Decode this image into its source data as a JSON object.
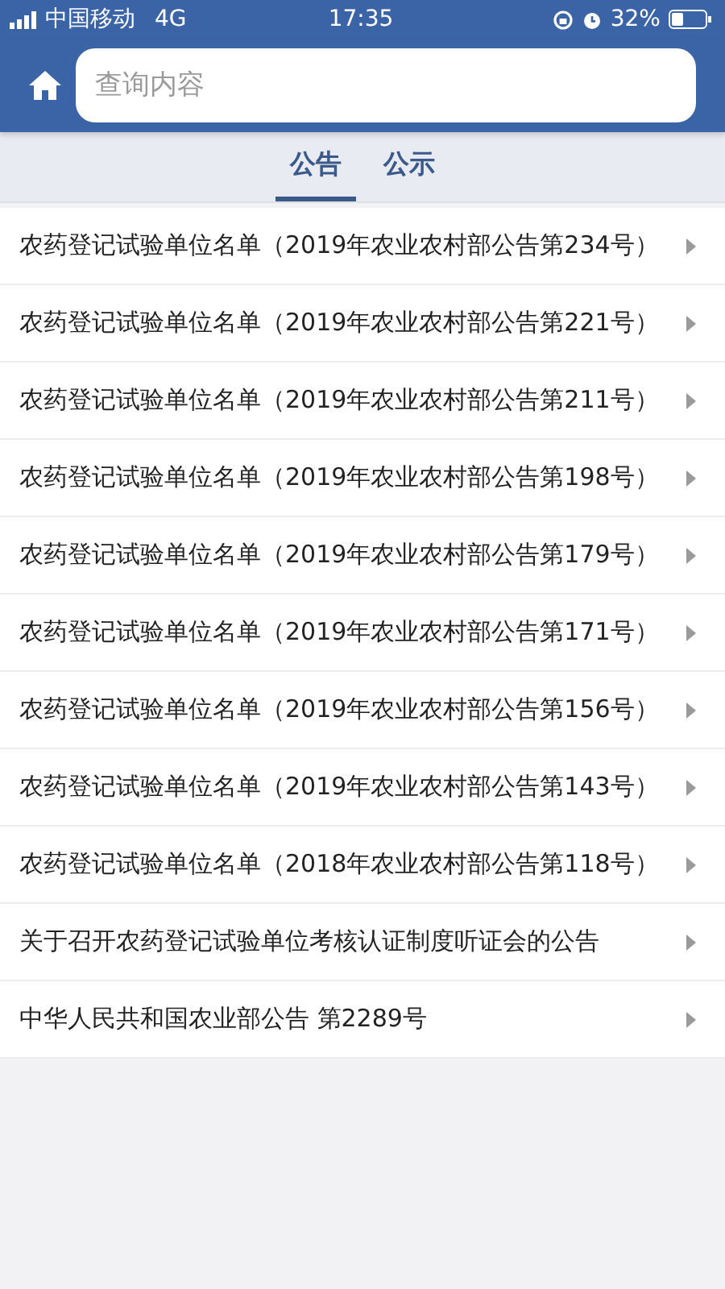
{
  "status_bar": {
    "carrier": "中国移动",
    "network": "4G",
    "time": "17:35",
    "battery": "32%"
  },
  "header": {
    "search": {
      "placeholder": "查询内容"
    }
  },
  "tabs": [
    {
      "label": "公告",
      "selected": true
    },
    {
      "label": "公示",
      "selected": false
    }
  ],
  "notices": [
    {
      "title": "农药登记试验单位名单（2019年农业农村部公告第234号）"
    },
    {
      "title": "农药登记试验单位名单（2019年农业农村部公告第221号）"
    },
    {
      "title": "农药登记试验单位名单（2019年农业农村部公告第211号）"
    },
    {
      "title": "农药登记试验单位名单（2019年农业农村部公告第198号）"
    },
    {
      "title": "农药登记试验单位名单（2019年农业农村部公告第179号）"
    },
    {
      "title": "农药登记试验单位名单（2019年农业农村部公告第171号）"
    },
    {
      "title": "农药登记试验单位名单（2019年农业农村部公告第156号）"
    },
    {
      "title": "农药登记试验单位名单（2019年农业农村部公告第143号）"
    },
    {
      "title": "农药登记试验单位名单（2018年农业农村部公告第118号）"
    },
    {
      "title": "关于召开农药登记试验单位考核认证制度听证会的公告"
    },
    {
      "title": "中华人民共和国农业部公告 第2289号"
    }
  ]
}
